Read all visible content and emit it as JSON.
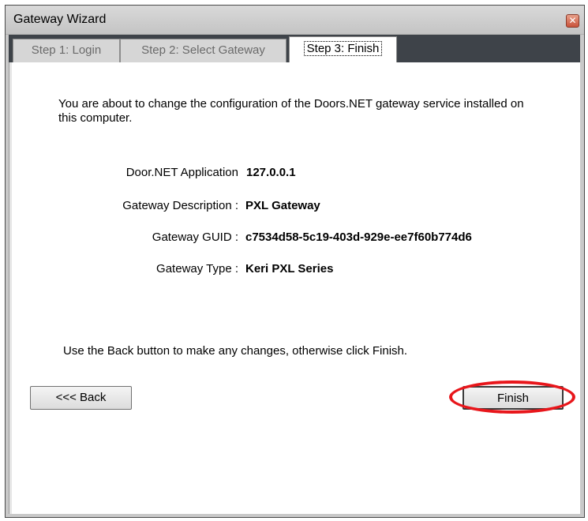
{
  "window": {
    "title": "Gateway Wizard",
    "close_glyph": "✕"
  },
  "tabs": [
    {
      "label": "Step 1: Login",
      "active": false
    },
    {
      "label": "Step 2: Select Gateway",
      "active": false
    },
    {
      "label": "Step 3: Finish",
      "active": true
    }
  ],
  "intro_text": "You are about to change the configuration of the Doors.NET gateway service installed on this computer.",
  "details": [
    {
      "label": "Door.NET Application",
      "value": "127.0.0.1"
    },
    {
      "label": "Gateway Description :",
      "value": "PXL Gateway"
    },
    {
      "label": "Gateway GUID :",
      "value": "c7534d58-5c19-403d-929e-ee7f60b774d6"
    },
    {
      "label": "Gateway Type :",
      "value": "Keri PXL Series"
    }
  ],
  "hint_text": "Use the Back button to make any changes, otherwise click Finish.",
  "buttons": {
    "back_label": "<<< Back",
    "finish_label": "Finish"
  },
  "colors": {
    "highlight_ring": "#e8161b",
    "tabstrip_background": "#3e4349"
  }
}
